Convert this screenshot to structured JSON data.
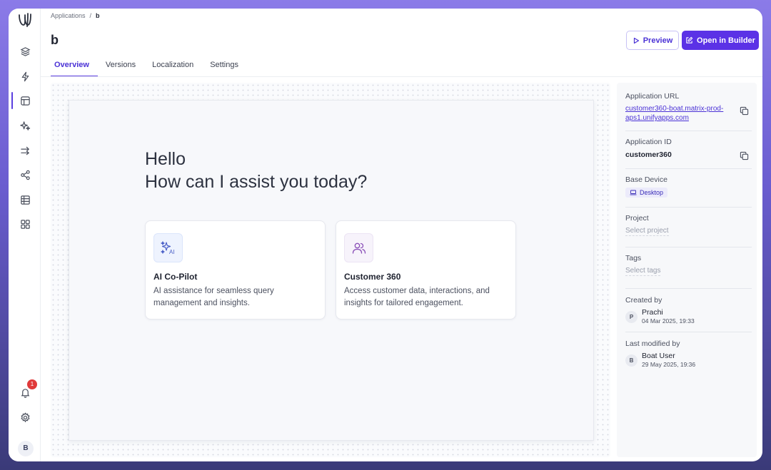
{
  "breadcrumb": {
    "root": "Applications",
    "sep": "/",
    "current": "b"
  },
  "header": {
    "title": "b",
    "preview_label": "Preview",
    "open_label": "Open in Builder"
  },
  "tabs": [
    {
      "label": "Overview",
      "active": true
    },
    {
      "label": "Versions"
    },
    {
      "label": "Localization"
    },
    {
      "label": "Settings"
    }
  ],
  "sidebar": {
    "icons": [
      "layers-icon",
      "bolt-icon",
      "layout-icon",
      "sparkle-icon",
      "transfer-icon",
      "share-icon",
      "table-icon",
      "grid-icon"
    ],
    "notification_count": "1",
    "avatar_initial": "B"
  },
  "canvas": {
    "greeting_line1": "Hello",
    "greeting_line2": "How can I assist you today?",
    "cards": [
      {
        "icon": "ai-sparkle-icon",
        "title": "AI Co-Pilot",
        "description": "AI assistance for seamless query management and insights."
      },
      {
        "icon": "users-icon",
        "title": "Customer 360",
        "description": "Access customer data, interactions, and insights for tailored engagement."
      }
    ]
  },
  "panel": {
    "url_label": "Application URL",
    "url_value": "customer360-boat.matrix-prod-aps1.unifyapps.com",
    "id_label": "Application ID",
    "id_value": "customer360",
    "device_label": "Base Device",
    "device_value": "Desktop",
    "project_label": "Project",
    "project_placeholder": "Select project",
    "tags_label": "Tags",
    "tags_placeholder": "Select tags",
    "created_label": "Created by",
    "created_initial": "P",
    "created_name": "Prachi",
    "created_time": "04 Mar 2025, 19:33",
    "modified_label": "Last modified by",
    "modified_initial": "B",
    "modified_name": "Boat User",
    "modified_time": "29 May 2025, 19:36"
  },
  "colors": {
    "accent": "#5b32e6",
    "badge": "#e03a3a",
    "link": "#4b32d6"
  }
}
